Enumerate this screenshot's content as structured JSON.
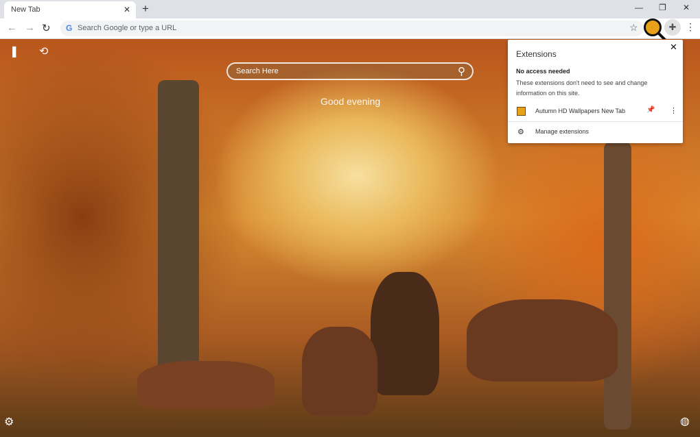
{
  "browser": {
    "tab_title": "New Tab",
    "omnibox_placeholder": "Search Google or type a URL",
    "google_g": "G"
  },
  "icons": {
    "close": "✕",
    "new_tab": "+",
    "minimize": "—",
    "maximize": "❐",
    "back": "←",
    "forward": "→",
    "reload": "↻",
    "star": "☆",
    "puzzle": "✚",
    "kebab": "⋮",
    "search": "⚲",
    "bookmark": "❚",
    "history": "⟲",
    "gear": "⚙",
    "globe": "◍",
    "pin": "📌"
  },
  "newtab": {
    "search_placeholder": "Search Here",
    "greeting": "Good evening"
  },
  "extensions_popup": {
    "title": "Extensions",
    "section_heading": "No access needed",
    "section_desc": "These extensions don't need to see and change information on this site.",
    "items": [
      {
        "name": "Autumn HD Wallpapers New Tab"
      }
    ],
    "manage_label": "Manage extensions"
  }
}
